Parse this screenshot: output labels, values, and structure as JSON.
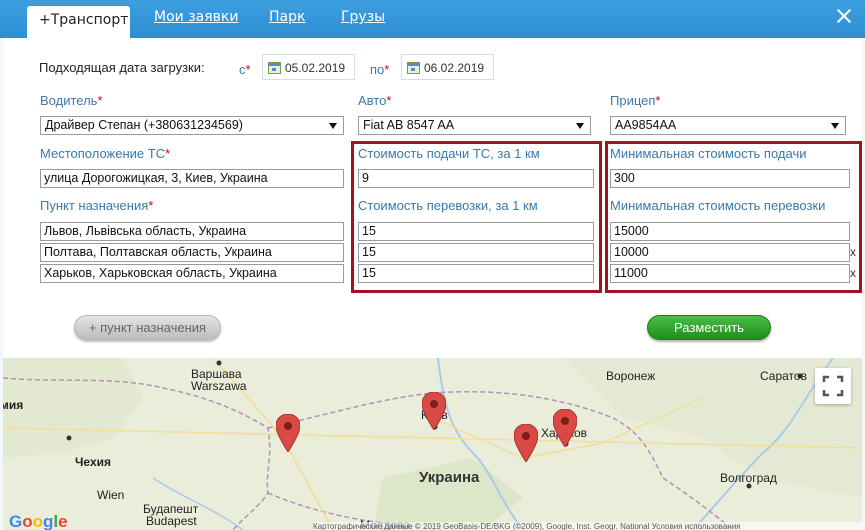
{
  "tabs": [
    {
      "label": "+Транспорт"
    },
    {
      "label": "Мои заявки"
    },
    {
      "label": "Парк"
    },
    {
      "label": "Грузы"
    }
  ],
  "date": {
    "label": "Подходящая дата загрузки:",
    "from_label": "с",
    "from_value": "05.02.2019",
    "to_label": "по",
    "to_value": "06.02.2019"
  },
  "driver": {
    "label": "Водитель",
    "value": "Драйвер Степан (+380631234569)"
  },
  "car": {
    "label": "Авто",
    "value": "Fiat AB 8547 AA"
  },
  "trailer": {
    "label": "Прицеп",
    "value": "AA9854AA"
  },
  "location": {
    "label": "Местоположение ТС",
    "value": "улица Дорогожицкая, 3, Киев, Украина"
  },
  "destination": {
    "label": "Пункт назначения",
    "values": [
      "Львов, Львівська область, Украина",
      "Полтава, Полтавская область, Украина",
      "Харьков, Харьковская область, Украина"
    ]
  },
  "delivery_cost": {
    "label": "Стоимость подачи ТС, за 1 км",
    "value": "9"
  },
  "transport_cost": {
    "label": "Стоимость перевозки, за 1 км",
    "values": [
      "15",
      "15",
      "15"
    ]
  },
  "min_delivery": {
    "label": "Минимальная стоимость подачи",
    "value": "300"
  },
  "min_transport": {
    "label": "Минимальная стоимость перевозки",
    "values": [
      "15000",
      "10000",
      "11000"
    ]
  },
  "remove_mark": "x",
  "buttons": {
    "add_destination": "+ пункт назначения",
    "place": "Разместить"
  },
  "map": {
    "cities": {
      "warsaw": "Варшава",
      "warszawa": "Warszawa",
      "voronezh": "Воронеж",
      "saratov": "Саратов",
      "kiev": "Киев",
      "kharkov": "Харьков",
      "czech": "Чехия",
      "vienna": "Wien",
      "budapest_ru": "Будапешт",
      "budapest": "Budapest",
      "ukraine": "Украина",
      "volgograd": "Волгоград",
      "moldova": "Молдова",
      "germany": "мия"
    },
    "google": "Google",
    "attribution": "Картографические данные © 2019 GeoBasis-DE/BKG (©2009), Google, Inst. Geogr. National    Условия использования"
  }
}
